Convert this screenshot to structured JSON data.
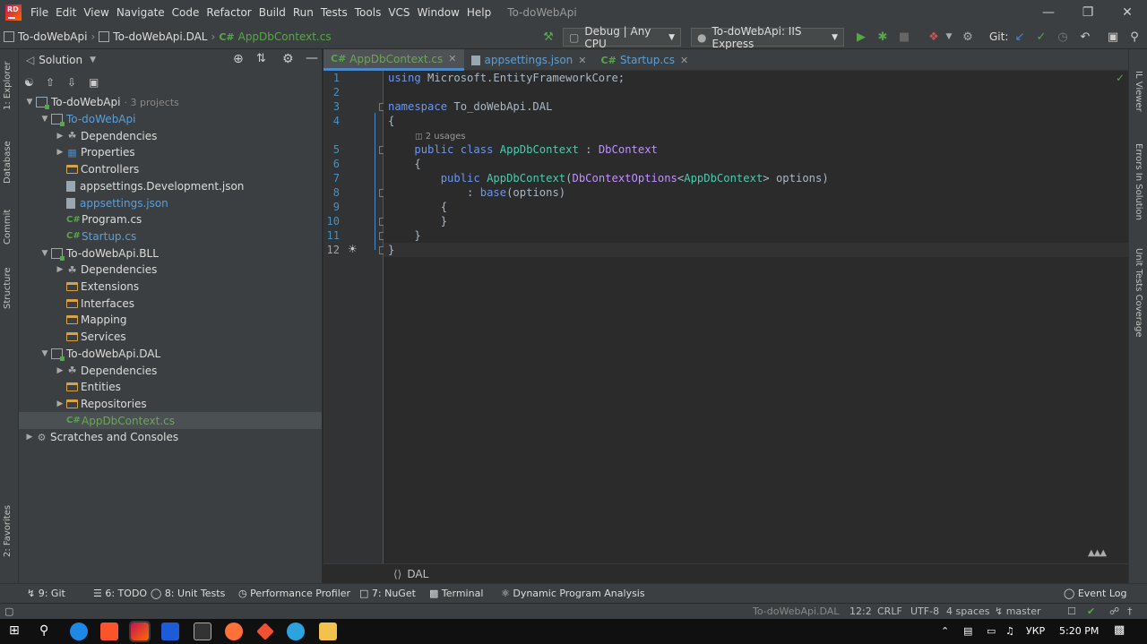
{
  "menu": {
    "items": [
      "File",
      "Edit",
      "View",
      "Navigate",
      "Code",
      "Refactor",
      "Build",
      "Run",
      "Tests",
      "Tools",
      "VCS",
      "Window",
      "Help"
    ],
    "window_title": "To-doWebApi"
  },
  "breadcrumb": {
    "items": [
      "To-doWebApi",
      "To-doWebApi.DAL",
      "AppDbContext.cs"
    ]
  },
  "toolbar": {
    "config": "Debug | Any CPU",
    "run_target": "To-doWebApi: IIS Express",
    "git_label": "Git:"
  },
  "solution": {
    "header": "Solution",
    "tree": [
      {
        "label": "To-doWebApi",
        "suffix": "· 3 projects",
        "level": 0,
        "kind": "solution",
        "expanded": true
      },
      {
        "label": "To-doWebApi",
        "level": 1,
        "kind": "project",
        "expanded": true
      },
      {
        "label": "Dependencies",
        "level": 2,
        "kind": "deps",
        "collapsed": true
      },
      {
        "label": "Properties",
        "level": 2,
        "kind": "props",
        "collapsed": true
      },
      {
        "label": "Controllers",
        "level": 2,
        "kind": "folder"
      },
      {
        "label": "appsettings.Development.json",
        "level": 2,
        "kind": "json"
      },
      {
        "label": "appsettings.json",
        "level": 2,
        "kind": "json"
      },
      {
        "label": "Program.cs",
        "level": 2,
        "kind": "cs"
      },
      {
        "label": "Startup.cs",
        "level": 2,
        "kind": "cs"
      },
      {
        "label": "To-doWebApi.BLL",
        "level": 1,
        "kind": "project",
        "expanded": true
      },
      {
        "label": "Dependencies",
        "level": 2,
        "kind": "deps",
        "collapsed": true
      },
      {
        "label": "Extensions",
        "level": 2,
        "kind": "folder"
      },
      {
        "label": "Interfaces",
        "level": 2,
        "kind": "folder"
      },
      {
        "label": "Mapping",
        "level": 2,
        "kind": "folder"
      },
      {
        "label": "Services",
        "level": 2,
        "kind": "folder"
      },
      {
        "label": "To-doWebApi.DAL",
        "level": 1,
        "kind": "project",
        "expanded": true
      },
      {
        "label": "Dependencies",
        "level": 2,
        "kind": "deps",
        "collapsed": true
      },
      {
        "label": "Entities",
        "level": 2,
        "kind": "folder"
      },
      {
        "label": "Repositories",
        "level": 2,
        "kind": "folder",
        "collapsed": true
      },
      {
        "label": "AppDbContext.cs",
        "level": 2,
        "kind": "cs",
        "selected": true
      },
      {
        "label": "Scratches and Consoles",
        "level": 0,
        "kind": "scratch",
        "collapsed": true
      }
    ]
  },
  "tabs": [
    {
      "label": "AppDbContext.cs",
      "kind": "cs",
      "active": true
    },
    {
      "label": "appsettings.json",
      "kind": "json",
      "active": false
    },
    {
      "label": "Startup.cs",
      "kind": "cs",
      "active": false
    }
  ],
  "editor": {
    "usages_hint": "2 usages",
    "lines": [
      "using Microsoft.EntityFrameworkCore;",
      "",
      "namespace To_doWebApi.DAL",
      "{",
      "    public class AppDbContext : DbContext",
      "    {",
      "        public AppDbContext(DbContextOptions<AppDbContext> options)",
      "            : base(options)",
      "        {",
      "        }",
      "    }",
      "}"
    ],
    "footer_breadcrumb": "DAL"
  },
  "left_tool_windows": [
    "1: Explorer",
    "Database",
    "Commit",
    "Structure",
    "2: Favorites"
  ],
  "right_tool_windows": [
    "IL Viewer",
    "Errors In Solution",
    "Unit Tests Coverage"
  ],
  "bottom_tools": [
    "9: Git",
    "6: TODO",
    "8: Unit Tests",
    "Performance Profiler",
    "7: NuGet",
    "Terminal",
    "Dynamic Program Analysis",
    "Event Log"
  ],
  "status": {
    "project": "To-doWebApi.DAL",
    "position": "12:2",
    "line_sep": "CRLF",
    "encoding": "UTF-8",
    "indent": "4 spaces",
    "branch": "master"
  },
  "taskbar": {
    "lang": "УКР",
    "time": "5:20 PM"
  }
}
